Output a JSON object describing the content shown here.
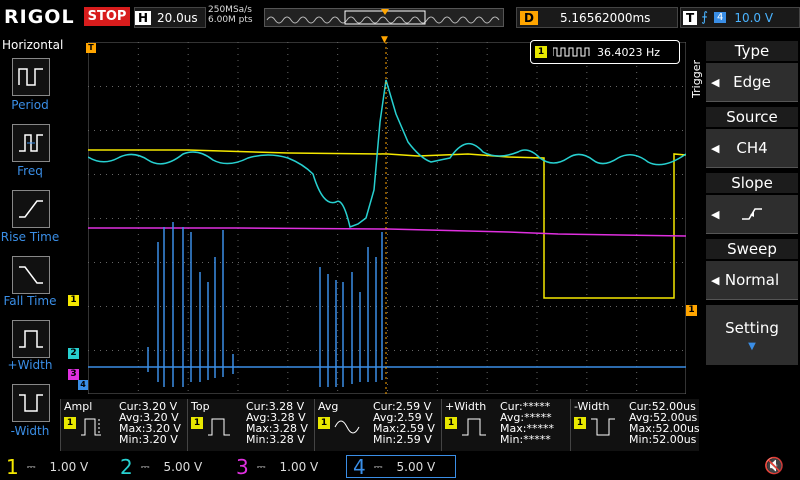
{
  "brand": "RIGOL",
  "run_state": "STOP",
  "timebase": {
    "label": "H",
    "value": "20.0us"
  },
  "sample": {
    "rate": "250MSa/s",
    "points": "6.00M pts"
  },
  "delay": {
    "label": "D",
    "value": "5.16562000ms"
  },
  "trigger_status": {
    "label": "T",
    "channel": "4",
    "level": "10.0 V"
  },
  "left_panel": {
    "title": "Horizontal",
    "items": [
      "Period",
      "Freq",
      "Rise Time",
      "Fall Time",
      "+Width",
      "-Width"
    ]
  },
  "freq_readout": {
    "channel": "1",
    "value": "36.4023 Hz"
  },
  "right_panel": {
    "side_label": "Trigger",
    "sections": [
      {
        "title": "Type",
        "value": "Edge"
      },
      {
        "title": "Source",
        "value": "CH4"
      },
      {
        "title": "Slope",
        "value": ""
      },
      {
        "title": "Sweep",
        "value": "Normal"
      }
    ],
    "setting": "Setting"
  },
  "markers": {
    "t": "T",
    "ch1": "1",
    "ch2": "2",
    "ch3": "3",
    "ch4": "4",
    "trig_right": "1"
  },
  "measurements": [
    {
      "name": "Ampl",
      "channel": "1",
      "cur": "Cur:3.20 V",
      "avg": "Avg:3.20 V",
      "max": "Max:3.20 V",
      "min": "Min:3.20 V"
    },
    {
      "name": "Top",
      "channel": "1",
      "cur": "Cur:3.28 V",
      "avg": "Avg:3.28 V",
      "max": "Max:3.28 V",
      "min": "Min:3.28 V"
    },
    {
      "name": "Avg",
      "channel": "1",
      "cur": "Cur:2.59 V",
      "avg": "Avg:2.59 V",
      "max": "Max:2.59 V",
      "min": "Min:2.59 V"
    },
    {
      "name": "+Width",
      "channel": "1",
      "cur": "Cur:*****",
      "avg": "Avg:*****",
      "max": "Max:*****",
      "min": "Min:*****"
    },
    {
      "name": "-Width",
      "channel": "1",
      "cur": "Cur:52.00us",
      "avg": "Avg:52.00us",
      "max": "Max:52.00us",
      "min": "Min:52.00us"
    }
  ],
  "channels": [
    {
      "num": "1",
      "scale": "1.00 V",
      "color": "#f5e800"
    },
    {
      "num": "2",
      "scale": "5.00 V",
      "color": "#27d0d0"
    },
    {
      "num": "3",
      "scale": "1.00 V",
      "color": "#e030e0"
    },
    {
      "num": "4",
      "scale": "5.00 V",
      "color": "#3a8ee6"
    }
  ],
  "colors": {
    "ch1": "#f5e800",
    "ch2": "#27d0d0",
    "ch3": "#e030e0",
    "ch4": "#3a8ee6",
    "accent": "#ffa500",
    "stop": "#d81c1c"
  }
}
